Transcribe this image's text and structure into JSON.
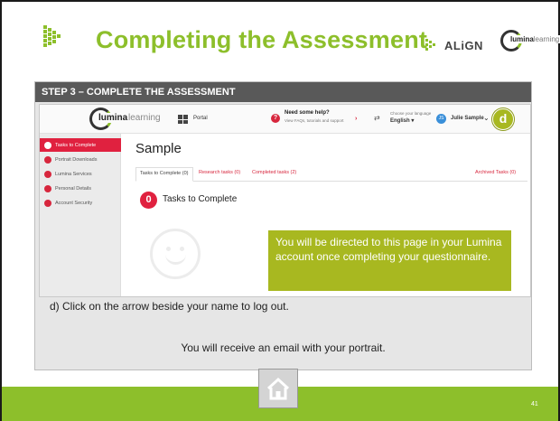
{
  "slide": {
    "title": "Completing the Assessment",
    "align_logo": "ALiGN",
    "lumina_logo": {
      "word1": "lumina",
      "word2": "learning"
    },
    "step_heading": "STEP 3 – COMPLETE THE ASSESSMENT",
    "instruction": "d)  Click on the arrow beside your name to log out.",
    "email_note": "You will receive an email with your portrait.",
    "page_number": "41",
    "colors": {
      "accent_green": "#8dbf2b",
      "callout_olive": "#a8b820",
      "portal_red": "#e0213f",
      "step_bar": "#595959"
    }
  },
  "portal": {
    "brand_word1": "lumina",
    "brand_word2": "learning",
    "portal_label": "Portal",
    "help_title": "Need some help?",
    "help_sub": "View FAQs, tutorials and support",
    "help_arrow": "›",
    "lang_title": "Choose your language",
    "lang_value": "English ▾",
    "avatar_initials": "JS",
    "user_name": "Julie Sample",
    "user_caret": "⌄",
    "badge": "d",
    "sidebar": [
      {
        "label": "Tasks to Complete",
        "active": true
      },
      {
        "label": "Portrait Downloads",
        "active": false
      },
      {
        "label": "Lumina Services",
        "active": false
      },
      {
        "label": "Personal Details",
        "active": false
      },
      {
        "label": "Account Security",
        "active": false
      }
    ],
    "page_title": "Sample",
    "tabs": [
      {
        "label": "Tasks to Complete (0)",
        "active": true
      },
      {
        "label": "Research tasks (0)",
        "active": false
      },
      {
        "label": "Completed tasks (2)",
        "active": false
      },
      {
        "label": "Archived Tasks (0)",
        "active": false
      }
    ],
    "task_count": "0",
    "task_label": "Tasks to Complete",
    "callout": "You will be directed to this page in your Lumina account once completing your questionnaire."
  }
}
